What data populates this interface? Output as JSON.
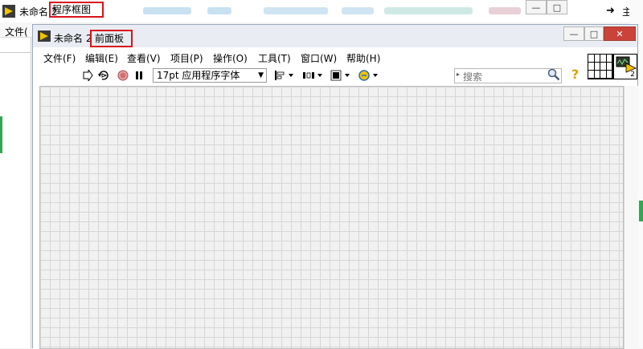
{
  "back_window": {
    "title_prefix": "未命名 2",
    "title_name": "程序框图",
    "menu_file": "文件(",
    "home_label": "主页",
    "buttons": {
      "minimize": "—",
      "maximize": "□"
    }
  },
  "front_window": {
    "title_prefix": "未命名 2",
    "title_name": "前面板",
    "buttons": {
      "minimize": "—",
      "maximize": "□",
      "close": "✕"
    },
    "menu": [
      {
        "label": "文件(F)"
      },
      {
        "label": "编辑(E)"
      },
      {
        "label": "查看(V)"
      },
      {
        "label": "项目(P)"
      },
      {
        "label": "操作(O)"
      },
      {
        "label": "工具(T)"
      },
      {
        "label": "窗口(W)"
      },
      {
        "label": "帮助(H)"
      }
    ],
    "toolbar": {
      "font": "17pt 应用程序字体",
      "search_placeholder": "搜索",
      "icons": [
        "run-arrow-icon",
        "run-continuously-icon",
        "abort-icon",
        "pause-icon",
        "align-objects-icon",
        "distribute-objects-icon",
        "resize-objects-icon",
        "reorder-icon",
        "search-icon",
        "help-icon"
      ]
    },
    "vi_icon_number": "2"
  },
  "colors": {
    "highlight_box": "#d8121b",
    "labview_logo": "#f2c200",
    "close_button": "#c9433a",
    "grid_line": "#d6d6d6",
    "canvas_bg": "#f1f1f1"
  }
}
